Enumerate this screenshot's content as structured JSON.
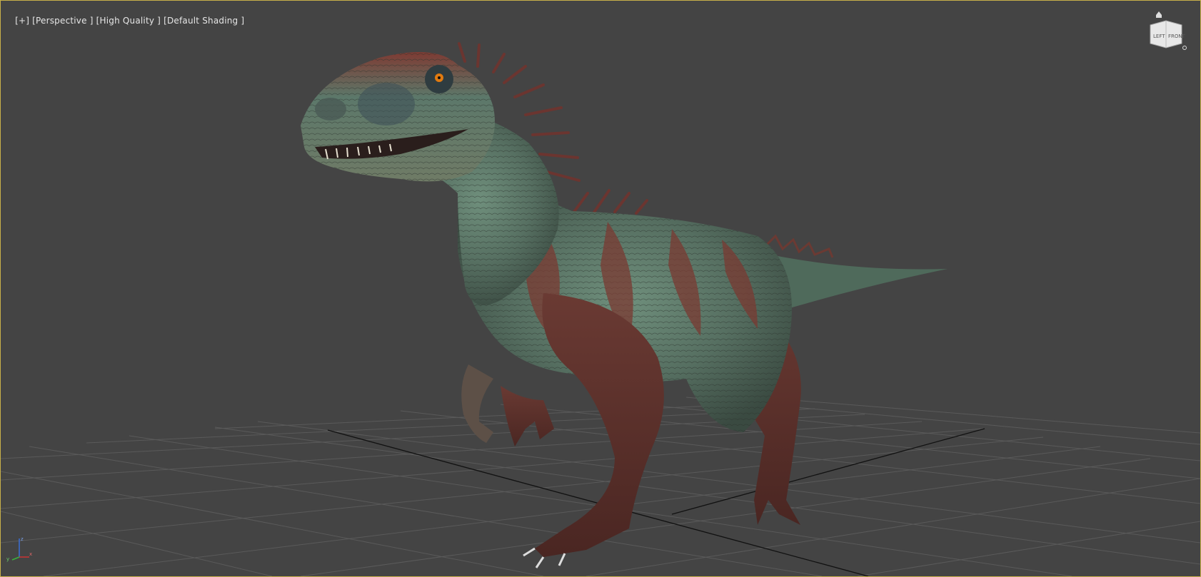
{
  "viewport": {
    "menu_label": "[+]",
    "view_label": "[Perspective ]",
    "quality_label": "[High Quality ]",
    "shading_label": "[Default Shading ]"
  },
  "viewcube": {
    "face_left": "LEFT",
    "face_front": "FRONT",
    "home_icon": "home-icon",
    "menu_icon": "viewcube-menu-icon"
  },
  "axis_tripod": {
    "x_label": "x",
    "y_label": "y",
    "z_label": "z"
  },
  "colors": {
    "viewport_bg": "#444444",
    "active_border": "#c8b04a",
    "grid_line": "#5a5a5a",
    "grid_axis": "#111111",
    "model_green": "#5d7d6c",
    "model_red": "#7a3a32"
  },
  "model": {
    "name_icon": "raptor-model"
  }
}
